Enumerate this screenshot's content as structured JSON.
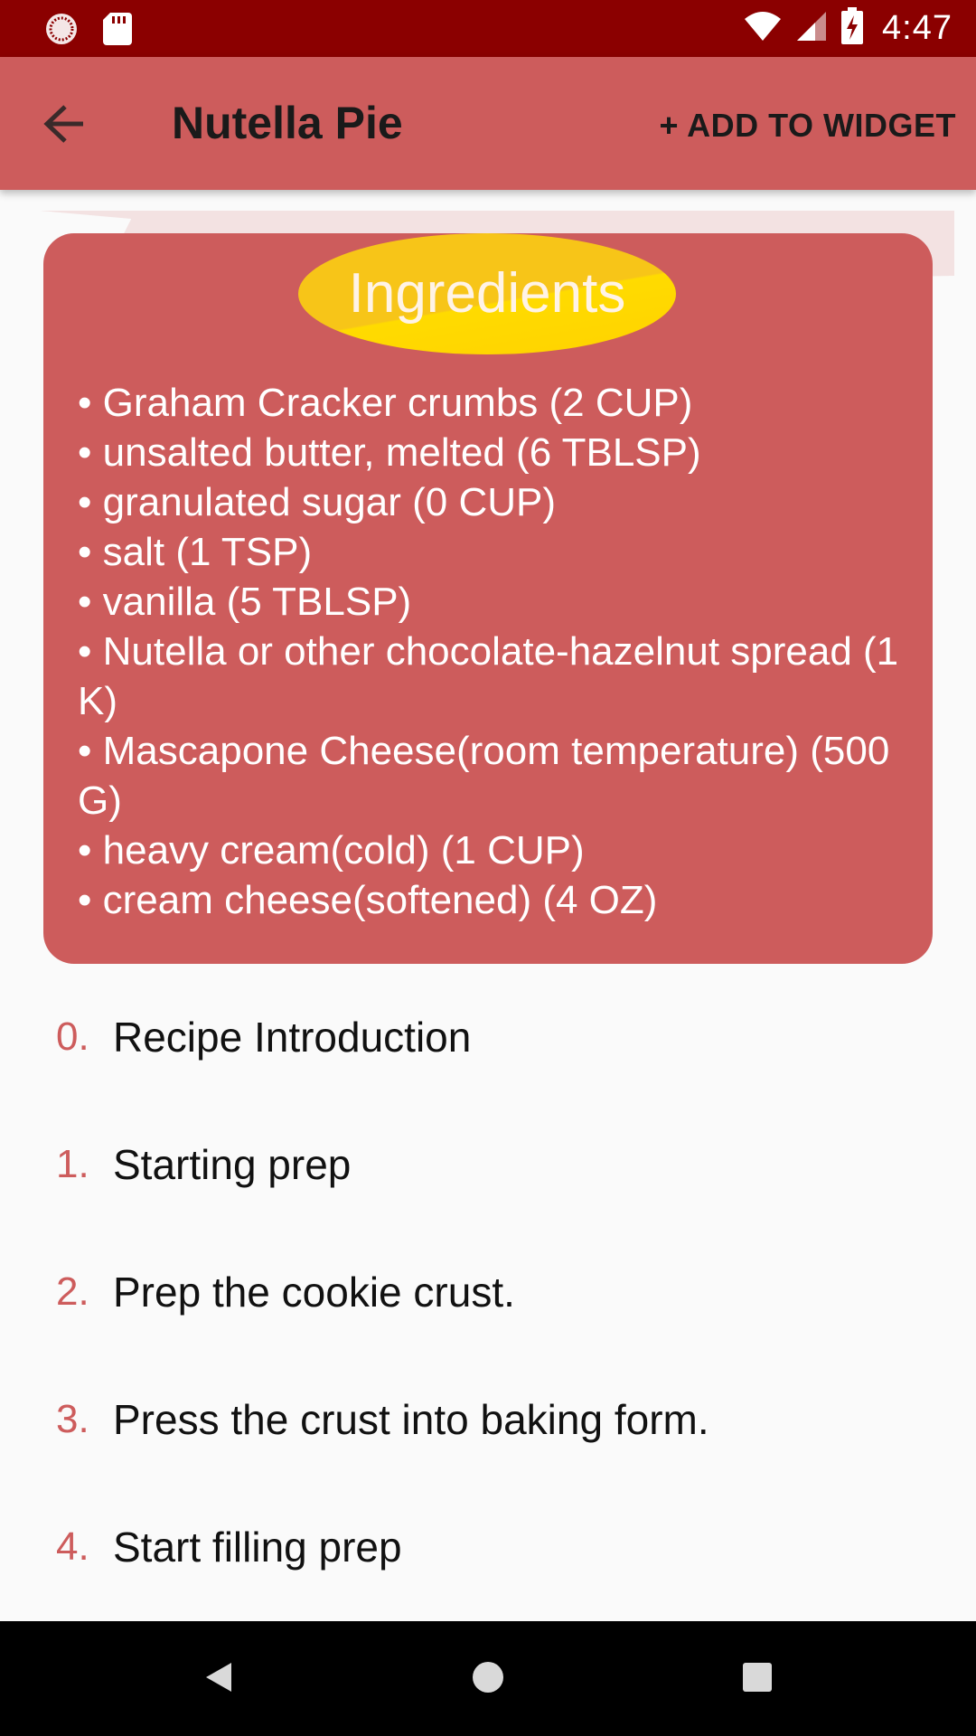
{
  "status_bar": {
    "time": "4:47",
    "icons": [
      "progress-circle-icon",
      "sd-card-icon",
      "wifi-icon",
      "signal-icon",
      "battery-charging-icon"
    ]
  },
  "app_bar": {
    "title": "Nutella Pie",
    "back_icon": "arrow-back-icon",
    "add_widget_label": "+ ADD TO WIDGET"
  },
  "ingredients": {
    "title": "Ingredients",
    "items": [
      "Graham Cracker crumbs (2 CUP)",
      "unsalted butter, melted (6 TBLSP)",
      "granulated sugar (0 CUP)",
      "salt (1 TSP)",
      "vanilla (5 TBLSP)",
      "Nutella or other chocolate-hazelnut spread (1 K)",
      "Mascapone Cheese(room temperature) (500 G)",
      "heavy cream(cold) (1 CUP)",
      "cream cheese(softened) (4 OZ)"
    ]
  },
  "steps": [
    {
      "number": "0.",
      "label": "Recipe Introduction"
    },
    {
      "number": "1.",
      "label": "Starting prep"
    },
    {
      "number": "2.",
      "label": "Prep the cookie crust."
    },
    {
      "number": "3.",
      "label": "Press the crust into baking form."
    },
    {
      "number": "4.",
      "label": "Start filling prep"
    }
  ],
  "nav_bar": {
    "icons": [
      "nav-back-icon",
      "nav-home-icon",
      "nav-recents-icon"
    ]
  },
  "colors": {
    "status_bar": "#8b0000",
    "primary": "#cd5c5c",
    "badge": "#f7c518",
    "step_number": "#cd5c5c"
  }
}
